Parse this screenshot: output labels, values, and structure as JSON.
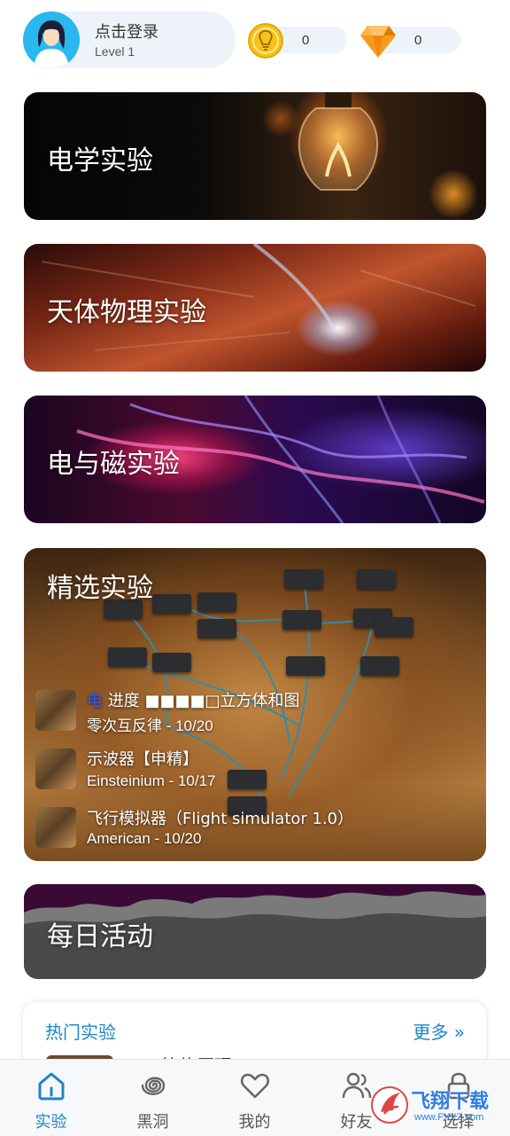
{
  "header": {
    "login_text": "点击登录",
    "level_text": "Level 1",
    "coins": "0",
    "gems": "0"
  },
  "cards": {
    "electric": "电学实验",
    "astro": "天体物理实验",
    "magnet": "电与磁实验",
    "featured": "精选实验",
    "daily": "每日活动"
  },
  "featured_items": [
    {
      "prefix": "电",
      "title": "进度 ■■■■□立方体和图",
      "sub": "零次互反律 - 10/20"
    },
    {
      "title": "示波器【申精】",
      "sub": "Einsteinium - 10/17"
    },
    {
      "title": "飞行模拟器（Flight simulator 1.0）",
      "sub": "American - 10/20"
    }
  ],
  "hot": {
    "title": "热门实验",
    "more": "更多 »",
    "item": "简约原理"
  },
  "nav": [
    {
      "label": "实验"
    },
    {
      "label": "黑洞"
    },
    {
      "label": "我的"
    },
    {
      "label": "好友"
    },
    {
      "label": "选择"
    }
  ],
  "watermark": "飞翔下载",
  "watermark_url": "www.FXXZ.com",
  "colors": {
    "accent": "#1c86c8",
    "coin": "#f7c21b",
    "gem": "#f38a12"
  }
}
